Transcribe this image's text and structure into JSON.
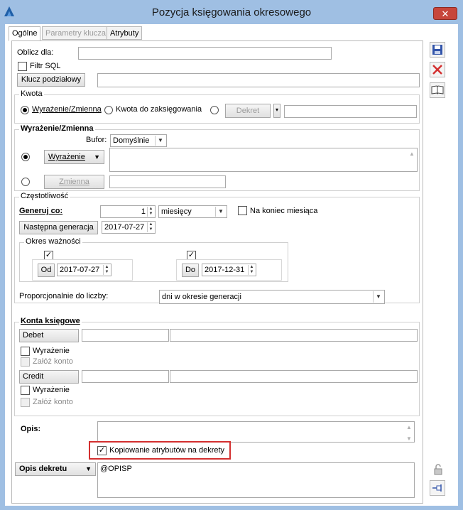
{
  "window": {
    "title": "Pozycja księgowania okresowego",
    "close_glyph": "✕"
  },
  "tabs": [
    {
      "label": "Ogólne"
    },
    {
      "label": "Parametry klucza"
    },
    {
      "label": "Atrybuty"
    }
  ],
  "form": {
    "oblicz_dla_label": "Oblicz dla:",
    "oblicz_dla_value": "",
    "filtr_sql_label": "Filtr SQL",
    "klucz_button": "Klucz podziałowy",
    "klucz_value": ""
  },
  "kwota": {
    "legend": "Kwota",
    "opt_wyrazenie": "Wyrażenie/Zmienna",
    "opt_kwota": "Kwota do zaksięgowania",
    "dekret_button": "Dekret",
    "dekret_value": ""
  },
  "wyrazenie": {
    "legend": "Wyrażenie/Zmienna",
    "bufor_label": "Bufor:",
    "bufor_value": "Domyślnie",
    "wyrazenie_button": "Wyrażenie",
    "zmienna_button": "Zmienna",
    "expression_text": "",
    "zmienna_value": ""
  },
  "czestotliwosc": {
    "legend": "Częstotliwość",
    "generuj_label": "Generuj co:",
    "generuj_value": "1",
    "unit_value": "miesięcy",
    "na_koniec_label": "Na koniec miesiąca",
    "nastepna_button": "Następna generacja",
    "nastepna_date": "2017-07-27",
    "okres_legend": "Okres ważności",
    "od_button": "Od",
    "od_date": "2017-07-27",
    "do_button": "Do",
    "do_date": "2017-12-31",
    "proporcjonalnie_label": "Proporcjonalnie do liczby:",
    "proporcjonalnie_value": "dni w okresie generacji"
  },
  "konta": {
    "legend": "Konta księgowe",
    "debet_button": "Debet",
    "credit_button": "Credit",
    "wyrazenie_label": "Wyrażenie",
    "zaloz_label": "Załóż konto"
  },
  "opis": {
    "label": "Opis:",
    "value": "",
    "kopiowanie_label": "Kopiowanie atrybutów na dekrety",
    "opis_dekretu_button": "Opis dekretu",
    "opis_dekretu_value": "@OPISP"
  },
  "colors": {
    "accent_red": "#d32f2f",
    "title_bar": "#9fbfe3",
    "save_blue": "#3355aa"
  },
  "icons": [
    "app-logo-icon",
    "save-icon",
    "cancel-icon",
    "book-icon",
    "lock-icon",
    "pin-icon"
  ]
}
